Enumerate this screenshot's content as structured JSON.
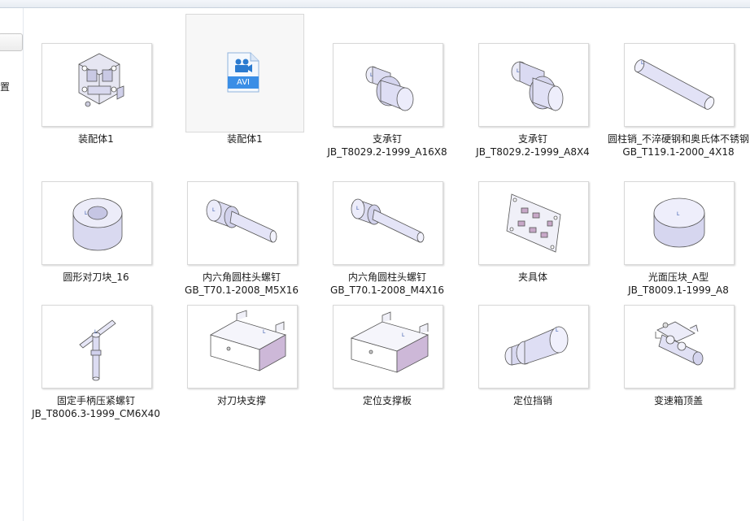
{
  "sidebar": {
    "text": "置"
  },
  "items": [
    {
      "label": "装配体1",
      "icon": "assembly-icon"
    },
    {
      "label": "装配体1",
      "icon": "avi-file-icon",
      "badge": "AVI"
    },
    {
      "label": "支承钉\nJB_T8029.2-1999_A16X8",
      "icon": "support-pin-icon"
    },
    {
      "label": "支承钉\nJB_T8029.2-1999_A8X4",
      "icon": "support-pin-icon"
    },
    {
      "label": "圆柱销_不淬硬钢和奥氏体不锈钢\nGB_T119.1-2000_4X18",
      "icon": "cylinder-pin-icon"
    },
    {
      "label": "圆形对刀块_16",
      "icon": "round-block-icon"
    },
    {
      "label": "内六角圆柱头螺钉\nGB_T70.1-2008_M5X16",
      "icon": "hex-socket-screw-icon"
    },
    {
      "label": "内六角圆柱头螺钉\nGB_T70.1-2008_M4X16",
      "icon": "hex-socket-screw-icon"
    },
    {
      "label": "夹具体",
      "icon": "fixture-body-icon"
    },
    {
      "label": "光面压块_A型\nJB_T8009.1-1999_A8",
      "icon": "press-block-icon"
    },
    {
      "label": "固定手柄压紧螺钉\nJB_T8006.3-1999_CM6X40",
      "icon": "handle-screw-icon"
    },
    {
      "label": "对刀块支撑",
      "icon": "block-support-icon"
    },
    {
      "label": "定位支撑板",
      "icon": "positioning-plate-icon"
    },
    {
      "label": "定位挡销",
      "icon": "positioning-pin-icon"
    },
    {
      "label": "变速箱顶盖",
      "icon": "gearbox-cover-icon"
    }
  ],
  "colors": {
    "part": "#e4e4f7",
    "part_shade": "#c7c7e6",
    "part_dark": "#a9a9d3",
    "edge": "#555566",
    "avi_blue": "#3a8ee6"
  }
}
